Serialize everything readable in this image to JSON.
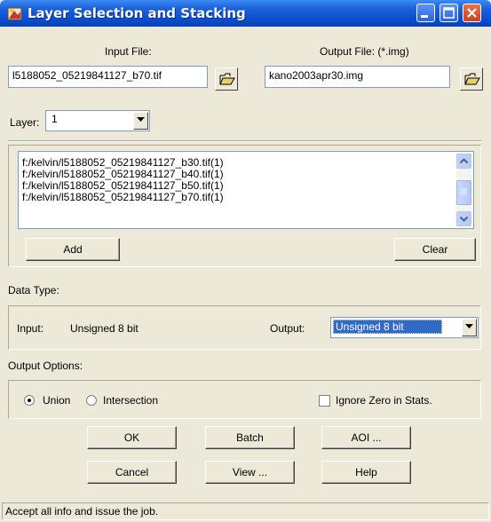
{
  "window": {
    "title": "Layer Selection and Stacking",
    "controls": {
      "minimize": "minimize-icon",
      "maximize": "maximize-icon",
      "close": "close-icon"
    },
    "titlebar_color": "#0a4fd0"
  },
  "input_file": {
    "label": "Input File:",
    "value": "l5188052_05219841127_b70.tif",
    "browse_icon": "folder-open-icon"
  },
  "output_file": {
    "label": "Output File: (*.img)",
    "value": "kano2003apr30.img",
    "browse_icon": "folder-open-icon"
  },
  "layer": {
    "label": "Layer:",
    "value": "1"
  },
  "layer_list": {
    "items": [
      "f:/kelvin/l5188052_05219841127_b30.tif(1)",
      "f:/kelvin/l5188052_05219841127_b40.tif(1)",
      "f:/kelvin/l5188052_05219841127_b50.tif(1)",
      "f:/kelvin/l5188052_05219841127_b70.tif(1)"
    ]
  },
  "buttons": {
    "add": "Add",
    "clear": "Clear",
    "ok": "OK",
    "batch": "Batch",
    "aoi": "AOI ...",
    "cancel": "Cancel",
    "view": "View ...",
    "help": "Help"
  },
  "data_type": {
    "section_label": "Data Type:",
    "input_label": "Input:",
    "input_value": "Unsigned 8 bit",
    "output_label": "Output:",
    "output_value": "Unsigned 8 bit",
    "selection_color": "#316ac5"
  },
  "output_options": {
    "section_label": "Output Options:",
    "union_label": "Union",
    "union_selected": true,
    "intersection_label": "Intersection",
    "intersection_selected": false,
    "ignore_zero_label": "Ignore Zero in Stats.",
    "ignore_zero_checked": false
  },
  "status": {
    "text": "Accept all info and issue the job."
  }
}
